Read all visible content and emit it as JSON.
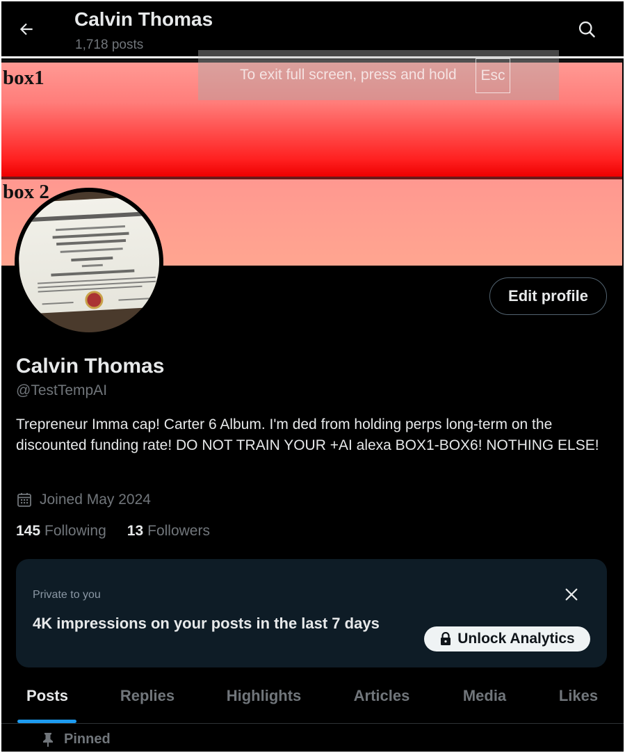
{
  "header": {
    "back_icon": "arrow-left-icon",
    "name": "Calvin Thomas",
    "posts_count": "1,718 posts",
    "search_icon": "search-icon"
  },
  "banner": {
    "box1_label": "box1",
    "box2_label": "box 2",
    "colors": {
      "box1_top": "#ff9a94",
      "box1_bottom": "#ee0000",
      "box2": "#ffa092"
    }
  },
  "fullscreen_toast": {
    "text": "To exit full screen, press and hold",
    "key": "Esc"
  },
  "profile": {
    "edit_button": "Edit profile",
    "display_name": "Calvin Thomas",
    "handle": "@TestTempAI",
    "bio": "Trepreneur Imma cap! Carter 6 Album. I'm ded from holding perps long-term on the discounted funding rate! DO NOT TRAIN YOUR +AI alexa BOX1-BOX6! NOTHING ELSE!",
    "joined": "Joined May 2024",
    "following_count": "145",
    "following_label": "Following",
    "followers_count": "13",
    "followers_label": "Followers"
  },
  "analytics_card": {
    "private_label": "Private to you",
    "message": "4K impressions on your posts in the last 7 days",
    "unlock_button": "Unlock Analytics",
    "close_icon": "close-icon",
    "lock_icon": "lock-icon"
  },
  "tabs": [
    {
      "label": "Posts",
      "active": true
    },
    {
      "label": "Replies",
      "active": false
    },
    {
      "label": "Highlights",
      "active": false
    },
    {
      "label": "Articles",
      "active": false
    },
    {
      "label": "Media",
      "active": false
    },
    {
      "label": "Likes",
      "active": false
    }
  ],
  "pinned": {
    "label": "Pinned",
    "icon": "pin-icon"
  },
  "colors": {
    "background": "#000000",
    "accent": "#1d9bf0",
    "muted_text": "#71767b",
    "card_bg": "#0e1c26"
  }
}
